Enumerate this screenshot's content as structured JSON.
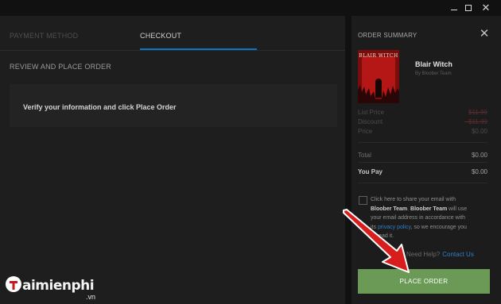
{
  "tabs": {
    "payment_method": "PAYMENT METHOD",
    "checkout": "CHECKOUT"
  },
  "review": {
    "title": "REVIEW AND PLACE ORDER",
    "info": "Verify your information and click Place Order"
  },
  "summary": {
    "title": "ORDER SUMMARY",
    "game_title": "Blair Witch",
    "publisher": "By Bloober Team",
    "cover_text": "BLAIR WITCH",
    "list_price_label": "List Price",
    "list_price": "$11.99",
    "discount_label": "Discount",
    "discount": "- $11.99",
    "price_label": "Price",
    "price": "$0.00",
    "total_label": "Total",
    "total": "$0.00",
    "you_pay_label": "You Pay",
    "you_pay": "$0.00"
  },
  "share": {
    "line1": "Click here to share your email with",
    "publisher_bold_1": "Bloober Team",
    "publisher_bold_2": "Bloober Team",
    "line2_rest": " will use",
    "line3": "your email address in accordance with",
    "line4_pre": "its ",
    "privacy_link": "privacy policy",
    "line4_post": ", so we encourage you",
    "line5": "to read it."
  },
  "help": {
    "text": "Need Help?",
    "link": "Contact Us"
  },
  "place_order": "PLACE ORDER",
  "watermark": {
    "brand": "aimienphi",
    "suffix": ".vn"
  },
  "colors": {
    "accent_tab": "#0d74c8",
    "place_order": "#6a9a55",
    "link": "#2f7fc8",
    "arrow": "#e01b1b"
  },
  "icons": {
    "close": "close-icon",
    "minimize": "minimize-icon",
    "maximize": "maximize-icon"
  }
}
